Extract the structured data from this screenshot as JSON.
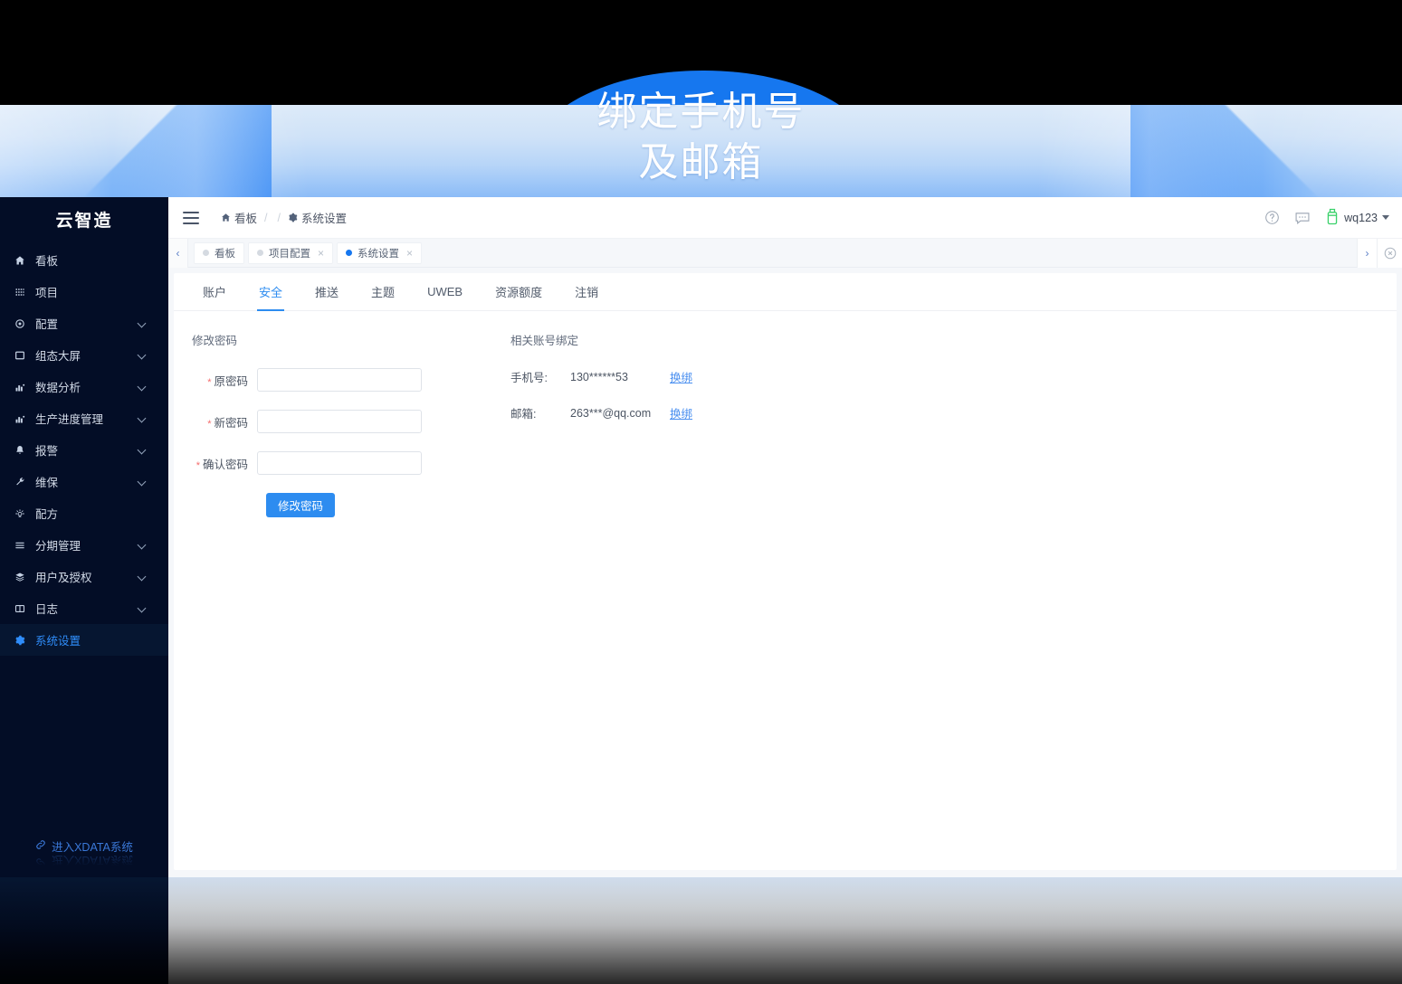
{
  "banner": {
    "title": "绑定手机号\n及邮箱",
    "accent": "#1677ef",
    "gradient_light": "#dceaf9",
    "gradient_dark": "#3e8ef5"
  },
  "sidebar": {
    "brand": "云智造",
    "items": [
      {
        "label": "看板",
        "icon": "home-icon",
        "expandable": false,
        "active": false
      },
      {
        "label": "项目",
        "icon": "grid-icon",
        "expandable": false,
        "active": false
      },
      {
        "label": "配置",
        "icon": "gear-dot-icon",
        "expandable": true,
        "active": false
      },
      {
        "label": "组态大屏",
        "icon": "monitor-icon",
        "expandable": true,
        "active": false
      },
      {
        "label": "数据分析",
        "icon": "bar-chart-icon",
        "expandable": true,
        "active": false
      },
      {
        "label": "生产进度管理",
        "icon": "bar-chart-icon",
        "expandable": true,
        "active": false
      },
      {
        "label": "报警",
        "icon": "bell-icon",
        "expandable": true,
        "active": false
      },
      {
        "label": "维保",
        "icon": "wrench-icon",
        "expandable": true,
        "active": false
      },
      {
        "label": "配方",
        "icon": "bulb-icon",
        "expandable": false,
        "active": false
      },
      {
        "label": "分期管理",
        "icon": "list-icon",
        "expandable": true,
        "active": false
      },
      {
        "label": "用户及授权",
        "icon": "layers-icon",
        "expandable": true,
        "active": false
      },
      {
        "label": "日志",
        "icon": "book-icon",
        "expandable": true,
        "active": false
      },
      {
        "label": "系统设置",
        "icon": "cog-icon",
        "expandable": false,
        "active": true
      }
    ],
    "footer_link": "进入XDATA系统",
    "footer_icon": "link-icon",
    "active_color": "#2f8dfa",
    "bg_color": "#030d26"
  },
  "topbar": {
    "menu_icon": "hamburger-icon",
    "breadcrumb": [
      {
        "label": "看板",
        "icon": "home-icon"
      },
      {
        "label": "系统设置",
        "icon": "gear-icon"
      }
    ],
    "separator": "/",
    "help_icon": "question-circle-icon",
    "message_icon": "message-icon",
    "avatar_icon": "user-avatar-icon",
    "username": "wq123",
    "caret_icon": "chevron-down-icon"
  },
  "tabstrip": {
    "left_arrow": "‹",
    "right_arrow": "›",
    "close_all_icon": "close-circle-icon",
    "tabs": [
      {
        "label": "看板",
        "active": false,
        "closable": false
      },
      {
        "label": "项目配置",
        "active": false,
        "closable": true
      },
      {
        "label": "系统设置",
        "active": true,
        "closable": true
      }
    ],
    "close_glyph": "×"
  },
  "subtabs": {
    "items": [
      {
        "label": "账户",
        "active": false
      },
      {
        "label": "安全",
        "active": true
      },
      {
        "label": "推送",
        "active": false
      },
      {
        "label": "主题",
        "active": false
      },
      {
        "label": "UWEB",
        "active": false
      },
      {
        "label": "资源额度",
        "active": false
      },
      {
        "label": "注销",
        "active": false
      }
    ],
    "accent": "#2d8cf0"
  },
  "password_form": {
    "section_title": "修改密码",
    "required_mark": "*",
    "fields": [
      {
        "label": "原密码",
        "value": "",
        "placeholder": ""
      },
      {
        "label": "新密码",
        "value": "",
        "placeholder": ""
      },
      {
        "label": "确认密码",
        "value": "",
        "placeholder": ""
      }
    ],
    "submit_label": "修改密码"
  },
  "account_binding": {
    "section_title": "相关账号绑定",
    "rows": [
      {
        "key": "手机号:",
        "value": "130******53",
        "action": "换绑"
      },
      {
        "key": "邮箱:",
        "value": "263***@qq.com",
        "action": "换绑"
      }
    ],
    "link_color": "#4a8ff0"
  }
}
